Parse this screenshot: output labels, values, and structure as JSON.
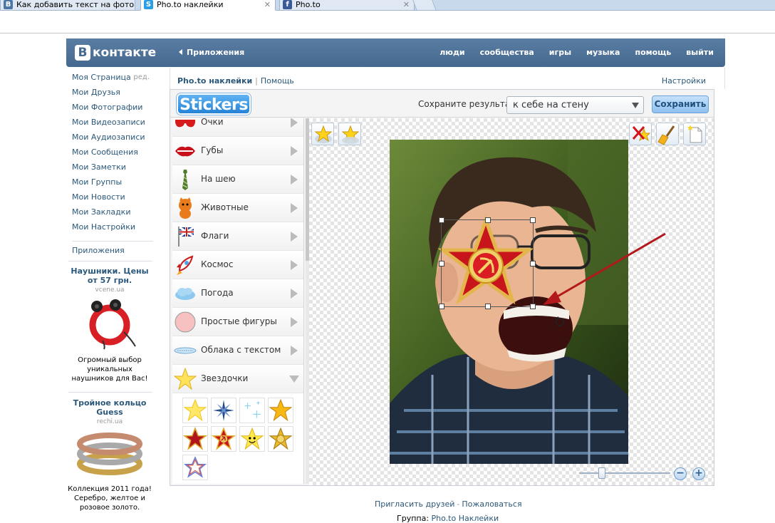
{
  "browser": {
    "tabs": [
      {
        "title": "Как добавить текст на фото",
        "favicon": "vk-favicon",
        "active": false
      },
      {
        "title": "Pho.to наклейки",
        "favicon": "skype-favicon",
        "active": true
      },
      {
        "title": "Pho.to",
        "favicon": "facebook-favicon",
        "active": false
      }
    ]
  },
  "header": {
    "logo_letter": "В",
    "logo_text": "контакте",
    "apps_link": "Приложения",
    "nav": [
      "люди",
      "сообщества",
      "игры",
      "музыка",
      "помощь",
      "выйти"
    ]
  },
  "sidebar": {
    "items": [
      {
        "label": "Моя Страница",
        "extra": "ред."
      },
      {
        "label": "Мои Друзья"
      },
      {
        "label": "Мои Фотографии"
      },
      {
        "label": "Мои Видеозаписи"
      },
      {
        "label": "Мои Аудиозаписи"
      },
      {
        "label": "Мои Сообщения"
      },
      {
        "label": "Мои Заметки"
      },
      {
        "label": "Мои Группы"
      },
      {
        "label": "Мои Новости"
      },
      {
        "label": "Мои Закладки"
      },
      {
        "label": "Мои Настройки"
      }
    ],
    "apps": "Приложения"
  },
  "ads": [
    {
      "title": "Наушники. Цены от 57 грн.",
      "domain": "vcene.ua",
      "text": "Огромный выбор уникальных наушников для Вас!"
    },
    {
      "title": "Тройное кольцо Guess",
      "domain": "rechi.ua",
      "text": "Коллекция 2011 года! Серебро, желтое и розовое золото."
    }
  ],
  "app": {
    "name": "Pho.to наклейки",
    "help": "Помощь",
    "settings": "Настройки",
    "logo": "Stickers",
    "save_label": "Сохраните результат",
    "save_target": "к себе на стену",
    "save_button": "Сохранить",
    "categories": [
      {
        "label": "Очки",
        "icon": "glasses-icon"
      },
      {
        "label": "Губы",
        "icon": "lips-icon"
      },
      {
        "label": "На шею",
        "icon": "tie-icon"
      },
      {
        "label": "Животные",
        "icon": "cat-icon"
      },
      {
        "label": "Флаги",
        "icon": "flag-icon"
      },
      {
        "label": "Космос",
        "icon": "rocket-icon"
      },
      {
        "label": "Погода",
        "icon": "cloud-icon"
      },
      {
        "label": "Простые фигуры",
        "icon": "circle-shape-icon"
      },
      {
        "label": "Облака с текстом",
        "icon": "speech-cloud-icon"
      },
      {
        "label": "Звездочки",
        "icon": "star-icon",
        "expanded": true
      }
    ],
    "stars": [
      "yellow-star",
      "blue-sparkle-star",
      "sparkles",
      "gold-star",
      "red-star",
      "soviet-star",
      "smiling-star",
      "sheriff-star",
      "outline-star"
    ],
    "zoom_level": 0.2
  },
  "footer": {
    "invite": "Пригласить друзей",
    "report": "Пожаловаться",
    "group_label": "Группа:",
    "group_link": "Pho.to Наклейки"
  },
  "colors": {
    "vk_blue": "#45688e",
    "link": "#2b587a",
    "save_button": "#8ec0ee"
  }
}
